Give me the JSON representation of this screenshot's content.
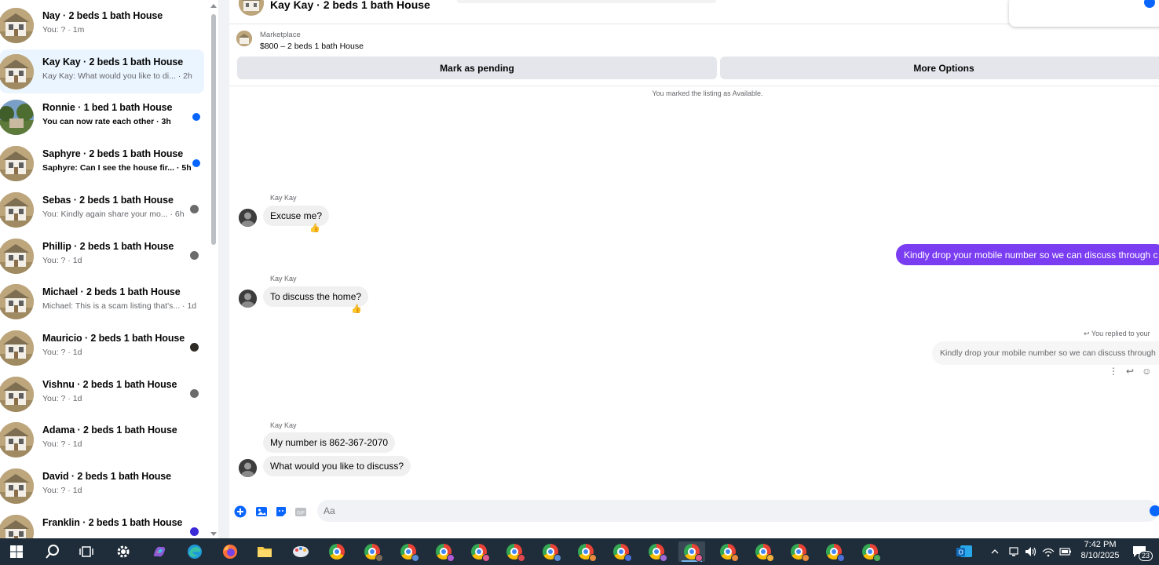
{
  "sidebar": {
    "conversations": [
      {
        "title": "Nay · 2 beds 1 bath House",
        "subtitle": "You: ? · 1m",
        "unread": false,
        "indicator": "none",
        "active": false
      },
      {
        "title": "Kay Kay · 2 beds 1 bath House",
        "subtitle": "Kay Kay: What would you like to di... · 2h",
        "unread": false,
        "indicator": "none",
        "active": true
      },
      {
        "title": "Ronnie · 1 bed 1 bath House",
        "subtitle": "You can now rate each other · 3h",
        "unread": true,
        "indicator": "dot",
        "active": false
      },
      {
        "title": "Saphyre · 2 beds 1 bath House",
        "subtitle": "Saphyre: Can I see the house fir... · 5h",
        "unread": true,
        "indicator": "dot",
        "active": false
      },
      {
        "title": "Sebas · 2 beds 1 bath House",
        "subtitle": "You: Kindly again share your mo... · 6h",
        "unread": false,
        "indicator": "avatar",
        "active": false
      },
      {
        "title": "Phillip · 2 beds 1 bath House",
        "subtitle": "You: ? · 1d",
        "unread": false,
        "indicator": "avatar",
        "active": false
      },
      {
        "title": "Michael · 2 beds 1 bath House",
        "subtitle": "Michael: This is a scam listing that's... · 1d",
        "unread": false,
        "indicator": "none",
        "active": false
      },
      {
        "title": "Mauricio · 2 beds 1 bath House",
        "subtitle": "You: ? · 1d",
        "unread": false,
        "indicator": "avatar-dark",
        "active": false
      },
      {
        "title": "Vishnu · 2 beds 1 bath House",
        "subtitle": "You: ? · 1d",
        "unread": false,
        "indicator": "avatar",
        "active": false
      },
      {
        "title": "Adama · 2 beds 1 bath House",
        "subtitle": "You: ? · 1d",
        "unread": false,
        "indicator": "none",
        "active": false
      },
      {
        "title": "David · 2 beds 1 bath House",
        "subtitle": "You: ? · 1d",
        "unread": false,
        "indicator": "none",
        "active": false
      },
      {
        "title": "Franklin · 2 beds 1 bath House",
        "subtitle": "",
        "unread": false,
        "indicator": "avatar-purple",
        "active": false
      }
    ]
  },
  "chat": {
    "header_name": "Kay Kay · 2 beds 1 bath House",
    "marketplace_label": "Marketplace",
    "listing_price": "$800 – 2 beds 1 bath House",
    "mark_pending_label": "Mark as pending",
    "more_options_label": "More Options",
    "status_text": "You marked the listing as Available.",
    "messages": {
      "m1_sender": "Kay Kay",
      "m1_text": "Excuse me?",
      "m1_reaction": "👍",
      "out1_text": "Kindly drop your mobile number so we can discuss through c",
      "m2_sender": "Kay Kay",
      "m2_text": "To discuss the home?",
      "m2_reaction": "👍",
      "reply_tag": "You replied to your",
      "reply_quote": "Kindly drop your mobile number so we can discuss through",
      "m3_sender": "Kay Kay",
      "m3_text1": "My number is 862-367-2070",
      "m3_text2": "What would you like to discuss?"
    },
    "composer": {
      "placeholder": "Aa"
    }
  },
  "taskbar": {
    "time": "7:42 PM",
    "date": "8/10/2025",
    "notification_count": "23"
  },
  "colors": {
    "accent": "#0866ff",
    "outgoing_bubble": "#7b3df2",
    "active_conversation_bg": "#ebf5ff",
    "taskbar_bg": "#1f2d3a"
  }
}
